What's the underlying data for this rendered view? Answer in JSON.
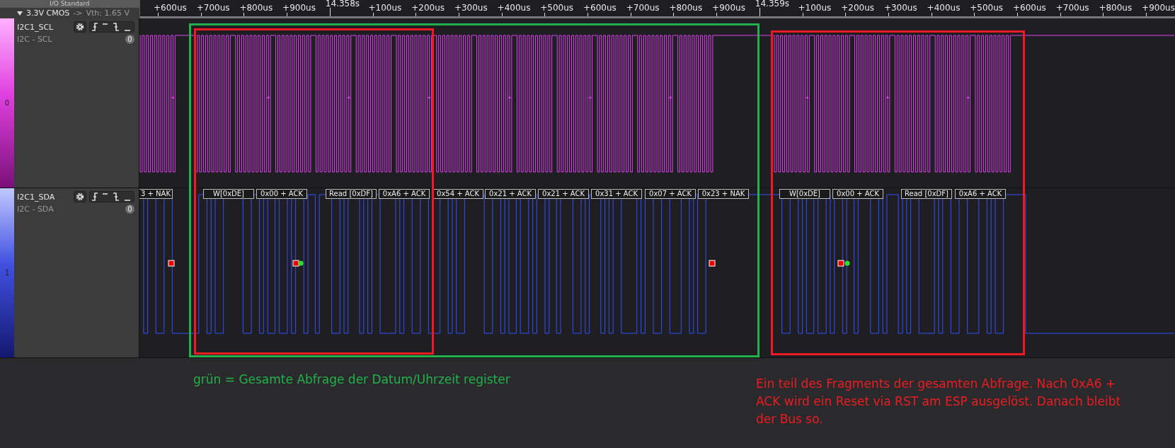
{
  "header": {
    "title": "I/O Standard",
    "standard": "3.3V CMOS",
    "arrow": "->",
    "threshold": "Vth: 1.65 V"
  },
  "timeline": [
    {
      "label": "+600us",
      "kind": "minor"
    },
    {
      "label": "+700us",
      "kind": "minor"
    },
    {
      "label": "+800us",
      "kind": "minor"
    },
    {
      "label": "+900us",
      "kind": "minor"
    },
    {
      "label": "14.358s",
      "kind": "major"
    },
    {
      "label": "+100us",
      "kind": "minor"
    },
    {
      "label": "+200us",
      "kind": "minor"
    },
    {
      "label": "+300us",
      "kind": "minor"
    },
    {
      "label": "+400us",
      "kind": "minor"
    },
    {
      "label": "+500us",
      "kind": "minor"
    },
    {
      "label": "+600us",
      "kind": "minor"
    },
    {
      "label": "+700us",
      "kind": "minor"
    },
    {
      "label": "+800us",
      "kind": "minor"
    },
    {
      "label": "+900us",
      "kind": "minor"
    },
    {
      "label": "14.359s",
      "kind": "major"
    },
    {
      "label": "+100us",
      "kind": "minor"
    },
    {
      "label": "+200us",
      "kind": "minor"
    },
    {
      "label": "+300us",
      "kind": "minor"
    },
    {
      "label": "+400us",
      "kind": "minor"
    },
    {
      "label": "+500us",
      "kind": "minor"
    },
    {
      "label": "+600us",
      "kind": "minor"
    },
    {
      "label": "+700us",
      "kind": "minor"
    },
    {
      "label": "+800us",
      "kind": "minor"
    },
    {
      "label": "+900us",
      "kind": "minor"
    }
  ],
  "channels": [
    {
      "index": "0",
      "name": "I2C1_SCL",
      "analyzer": "I2C - SCL",
      "badge": "0",
      "kind": "clock"
    },
    {
      "index": "1",
      "name": "I2C1_SDA",
      "analyzer": "I2C - SDA",
      "badge": "0",
      "kind": "data",
      "frames": [
        "3 + NAK",
        "W[0xDE]",
        "0x00 + ACK",
        "Read [0xDF]",
        "0xA6 + ACK",
        "0x54 + ACK",
        "0x21 + ACK",
        "0x21 + ACK",
        "0x31 + ACK",
        "0x07 + ACK",
        "0x23 + NAK",
        "W[0xDE]",
        "0x00 + ACK",
        "Read [0xDF]",
        "0xA6 + ACK"
      ]
    }
  ],
  "annotation_boxes": [
    {
      "color": "#22b14c"
    },
    {
      "color": "#ed1c24"
    },
    {
      "color": "#ed1c24"
    }
  ],
  "notes": [
    {
      "text": "grün = Gesamte Abfrage der Datum/Uhrzeit register",
      "color": "#22b14c"
    },
    {
      "text": "Ein teil des Fragments der gesamten Abfrage. Nach 0xA6 + ACK wird ein Reset via RST am ESP ausgelöst. Danach bleibt der Bus so.",
      "color": "#ed1c24"
    }
  ]
}
